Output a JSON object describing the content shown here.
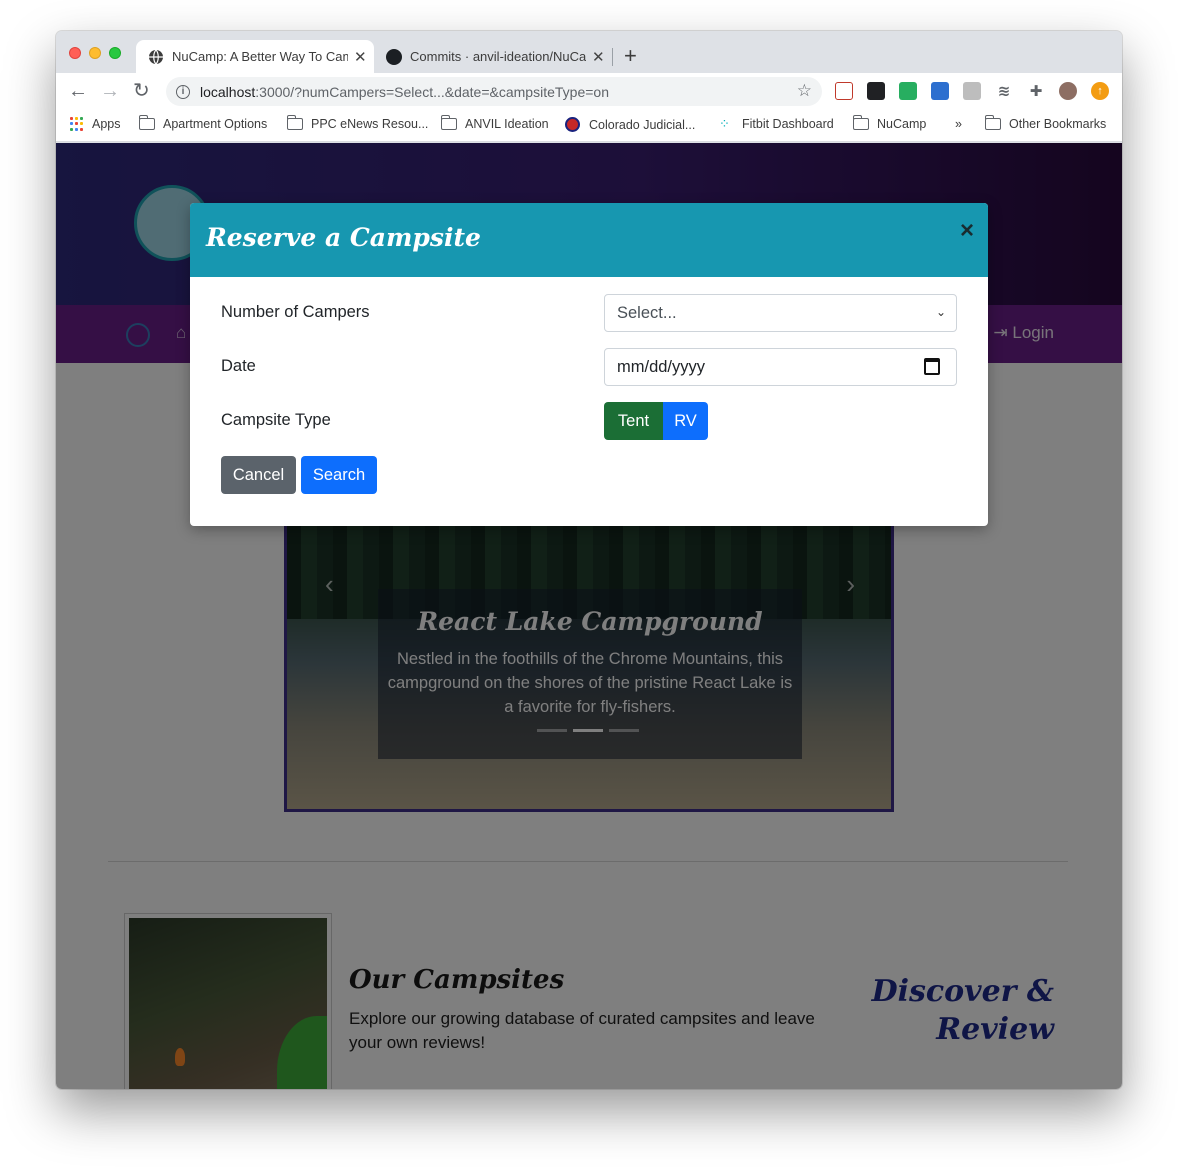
{
  "browser": {
    "tabs": [
      {
        "title": "NuCamp: A Better Way To Camp",
        "active": true
      },
      {
        "title": "Commits · anvil-ideation/NuCamp",
        "active": false
      }
    ],
    "url_host": "localhost",
    "url_rest": ":3000/?numCampers=Select...&date=&campsiteType=on",
    "bookmarks": [
      "Apps",
      "Apartment Options",
      "PPC eNews Resou...",
      "ANVIL Ideation",
      "Colorado Judicial...",
      "Fitbit Dashboard",
      "NuCamp",
      "»",
      "Other Bookmarks"
    ]
  },
  "page": {
    "nav_login": "Login",
    "carousel": {
      "title": "React Lake Campground",
      "text": "Nestled in the foothills of the Chrome Mountains, this campground on the shores of the pristine React Lake is a favorite for fly-fishers."
    },
    "media": {
      "title": "Our Campsites",
      "text": "Explore our growing database of curated campsites and leave your own reviews!",
      "right_heading": "Discover & Review"
    }
  },
  "modal": {
    "title": "Reserve a Campsite",
    "close": "×",
    "fields": {
      "campers_label": "Number of Campers",
      "campers_value": "Select...",
      "date_label": "Date",
      "date_placeholder": "mm/dd/yyyy",
      "type_label": "Campsite Type",
      "type_options": [
        "Tent",
        "RV"
      ],
      "type_selected": "Tent"
    },
    "buttons": {
      "cancel": "Cancel",
      "search": "Search"
    }
  },
  "colors": {
    "modal_header": "#1797b0",
    "tent_active": "#1b6e35",
    "primary": "#0d6efd",
    "secondary": "#5b636b",
    "jumbotron": "#2e2a7e",
    "navbar": "#6a1e8a"
  }
}
